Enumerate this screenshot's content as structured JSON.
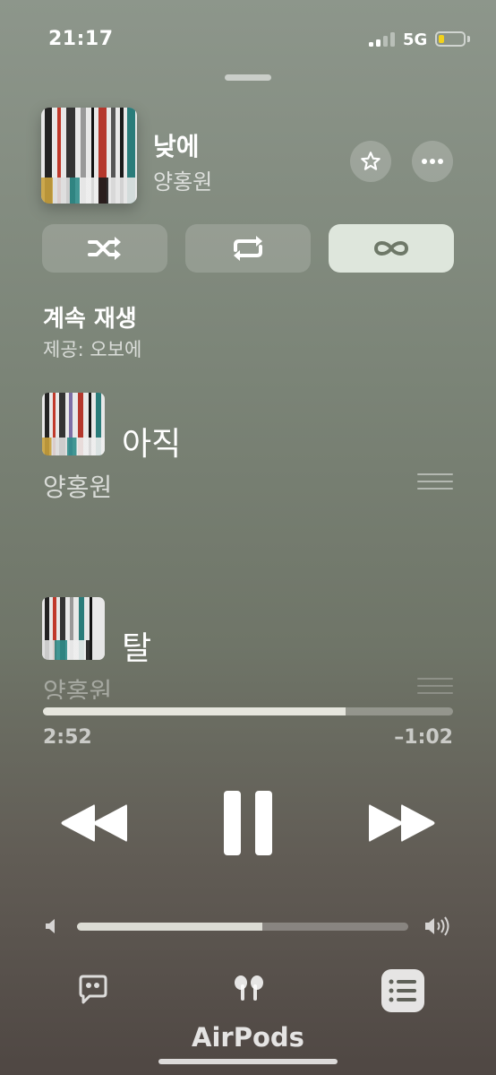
{
  "status_bar": {
    "time": "21:17",
    "network": "5G",
    "battery_level": 0.2
  },
  "now_playing": {
    "title": "낮에",
    "artist": "양홍원"
  },
  "controls": {
    "favorite_icon": "star-icon",
    "more_icon": "ellipsis-icon",
    "shuffle_icon": "shuffle-icon",
    "repeat_icon": "repeat-icon",
    "autoplay_icon": "infinity-icon"
  },
  "autoplay": {
    "title": "계속 재생",
    "subtitle": "제공: 오보에"
  },
  "queue": [
    {
      "title": "아직",
      "artist": "양홍원"
    },
    {
      "title": "탈",
      "artist": "양홍원"
    }
  ],
  "playback": {
    "elapsed": "2:52",
    "remaining": "–1:02",
    "progress": 0.737
  },
  "volume": {
    "level": 0.56
  },
  "bottom": {
    "output_label": "AirPods"
  },
  "colors": {
    "accent_active": "#e6eee4",
    "battery_yellow": "#f2d21b"
  }
}
